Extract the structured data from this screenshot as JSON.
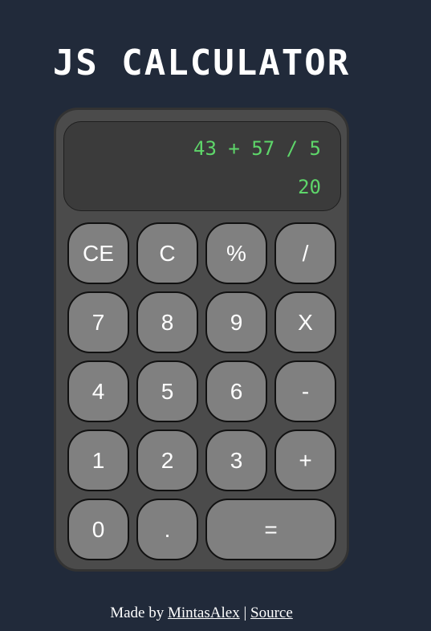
{
  "page": {
    "title": "JS CALCULATOR"
  },
  "display": {
    "expression": "43 + 57 / 5",
    "result": "20"
  },
  "keys": {
    "ce": "CE",
    "c": "C",
    "percent": "%",
    "divide": "/",
    "seven": "7",
    "eight": "8",
    "nine": "9",
    "multiply": "X",
    "four": "4",
    "five": "5",
    "six": "6",
    "minus": "-",
    "one": "1",
    "two": "2",
    "three": "3",
    "plus": "+",
    "zero": "0",
    "dot": ".",
    "equals": "="
  },
  "footer": {
    "prefix": "Made by",
    "author_link": "MintasAlex",
    "separator": "|",
    "source_link": "Source"
  },
  "colors": {
    "background": "#212a3a",
    "body": "#4b4b4b",
    "screen": "#3b3b3b",
    "display_text": "#5ed66a",
    "key": "#808080"
  }
}
